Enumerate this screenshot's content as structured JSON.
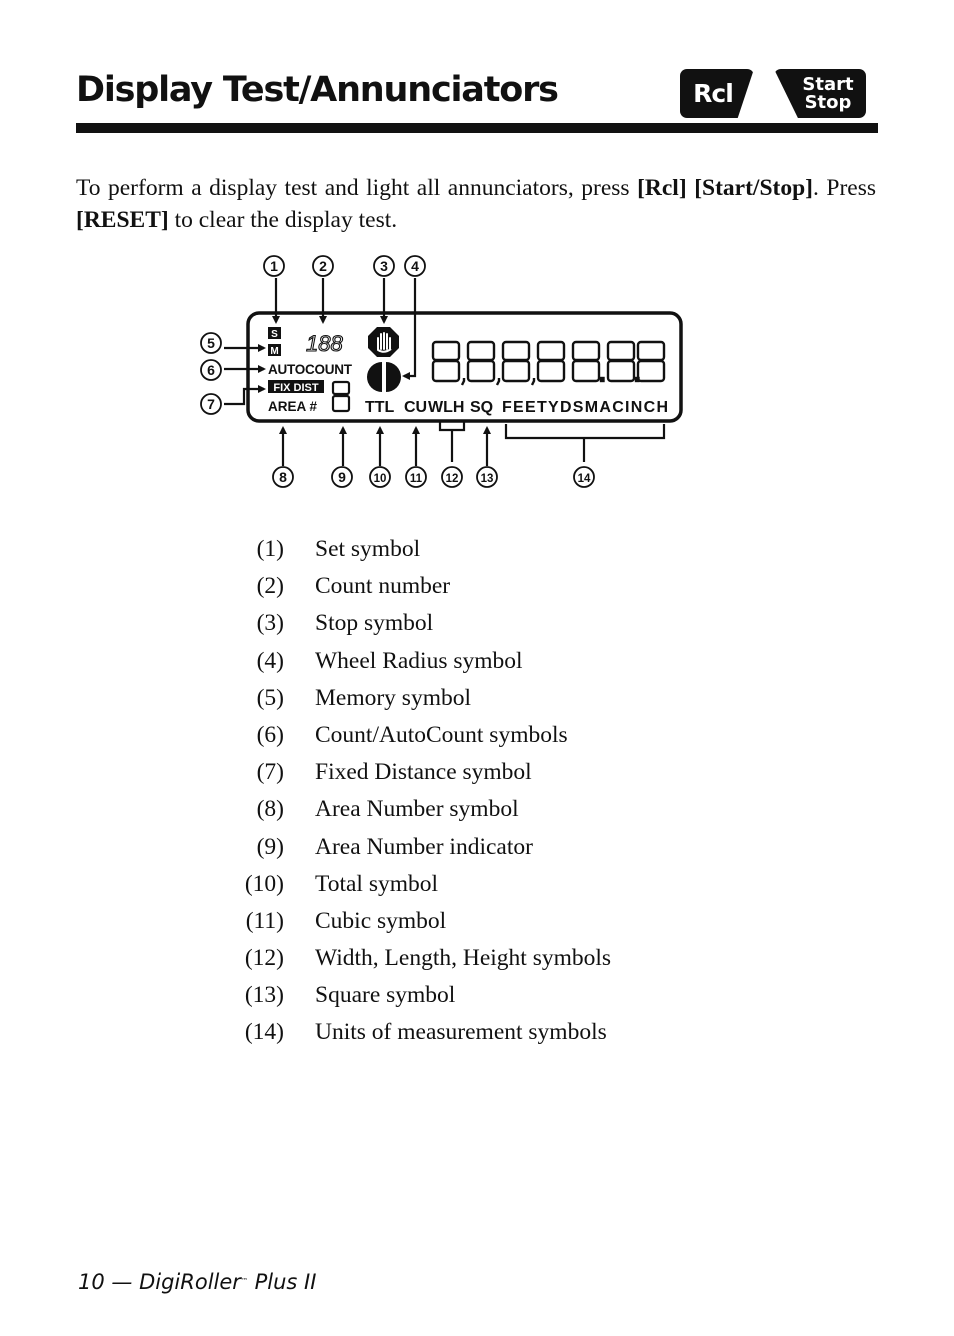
{
  "header": {
    "title": "Display Test/Annunciators",
    "keys": [
      {
        "label": "Rcl",
        "icon": "rcl-key-icon"
      },
      {
        "label_line1": "Start",
        "label_line2": "Stop",
        "icon": "start-stop-key-icon"
      }
    ]
  },
  "intro": {
    "part1": "To perform a display test and light all annunciators, press ",
    "key1": "[Rcl]",
    "space": " ",
    "key2": "[Start/Stop]",
    "part2": ". Press ",
    "key3": "[RESET]",
    "part3": " to clear the display test."
  },
  "diagram": {
    "callouts": [
      "1",
      "2",
      "3",
      "4",
      "5",
      "6",
      "7",
      "8",
      "9",
      "10",
      "11",
      "12",
      "13",
      "14"
    ],
    "lcd": {
      "set_symbol": "S",
      "memory_symbol": "M",
      "count_number": "188",
      "autocount": "AUTOCOUNT",
      "fix_dist": "FIX DIST",
      "area": "AREA #",
      "area_indicator": "8",
      "main_digits": "8,8,8,8888",
      "ttl": "TTL",
      "cu": "CU",
      "wlh": "WLH",
      "sq": "SQ",
      "units": "FEETYDSMACINCH",
      "stop_icon": "stop-hand-icon",
      "wheel_icon": "wheel-radius-icon"
    }
  },
  "legend": [
    {
      "num": "(1)",
      "text": "Set symbol"
    },
    {
      "num": "(2)",
      "text": "Count number"
    },
    {
      "num": "(3)",
      "text": "Stop symbol"
    },
    {
      "num": "(4)",
      "text": "Wheel Radius symbol"
    },
    {
      "num": "(5)",
      "text": "Memory symbol"
    },
    {
      "num": "(6)",
      "text": "Count/AutoCount symbols"
    },
    {
      "num": "(7)",
      "text": "Fixed Distance symbol"
    },
    {
      "num": "(8)",
      "text": "Area Number symbol"
    },
    {
      "num": "(9)",
      "text": "Area Number indicator"
    },
    {
      "num": "(10)",
      "text": "Total symbol"
    },
    {
      "num": "(11)",
      "text": "Cubic symbol"
    },
    {
      "num": "(12)",
      "text": "Width, Length, Height symbols"
    },
    {
      "num": "(13)",
      "text": "Square symbol"
    },
    {
      "num": "(14)",
      "text": "Units of measurement symbols"
    }
  ],
  "footer": {
    "page": "10",
    "dash": " — ",
    "product": "DigiRoller",
    "tm": "™",
    "suffix": " Plus II"
  }
}
